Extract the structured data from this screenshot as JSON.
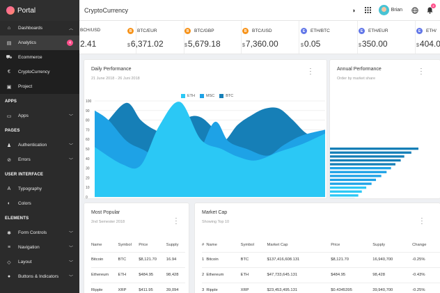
{
  "brand": {
    "name": "Portal"
  },
  "sidebar": {
    "items": [
      {
        "type": "item",
        "name": "dashboards",
        "label": "Dashboards",
        "icon": "home-icon",
        "glyph": "⌂",
        "chevron": "up"
      },
      {
        "type": "item",
        "name": "analytics",
        "label": "Analytics",
        "icon": "document-icon",
        "glyph": "▤",
        "sub": true,
        "active": true,
        "badge": "4"
      },
      {
        "type": "item",
        "name": "ecommerce",
        "label": "Ecommerce",
        "icon": "cart-icon",
        "glyph": "⛟",
        "sub": true
      },
      {
        "type": "item",
        "name": "cryptocurrency",
        "label": "CryptoCurrency",
        "icon": "euro-icon",
        "glyph": "€",
        "sub": true
      },
      {
        "type": "item",
        "name": "project",
        "label": "Project",
        "icon": "briefcase-icon",
        "glyph": "▣",
        "sub": true
      },
      {
        "type": "section",
        "label": "APPS"
      },
      {
        "type": "item",
        "name": "apps",
        "label": "Apps",
        "icon": "monitor-icon",
        "glyph": "▭",
        "chevron": "down"
      },
      {
        "type": "section",
        "label": "PAGES"
      },
      {
        "type": "item",
        "name": "authentication",
        "label": "Authentication",
        "icon": "user-icon",
        "glyph": "♟",
        "chevron": "down"
      },
      {
        "type": "item",
        "name": "errors",
        "label": "Errors",
        "icon": "alert-icon",
        "glyph": "⊘",
        "chevron": "down"
      },
      {
        "type": "section",
        "label": "USER INTERFACE"
      },
      {
        "type": "item",
        "name": "typography",
        "label": "Typography",
        "icon": "typography-icon",
        "glyph": "A"
      },
      {
        "type": "item",
        "name": "colors",
        "label": "Colors",
        "icon": "palette-icon",
        "glyph": "◐"
      },
      {
        "type": "section",
        "label": "ELEMENTS"
      },
      {
        "type": "item",
        "name": "form-controls",
        "label": "Form Controls",
        "icon": "star-icon",
        "glyph": "✱",
        "chevron": "down"
      },
      {
        "type": "item",
        "name": "navigation",
        "label": "Navigation",
        "icon": "menu-icon",
        "glyph": "≡",
        "chevron": "down"
      },
      {
        "type": "item",
        "name": "layout",
        "label": "Layout",
        "icon": "layout-icon",
        "glyph": "◇",
        "chevron": "down"
      },
      {
        "type": "item",
        "name": "buttons-indicators",
        "label": "Buttons & Indicators",
        "icon": "buttons-icon",
        "glyph": "●",
        "chevron": "down"
      }
    ]
  },
  "header": {
    "title": "CryptoCurrency",
    "user": "Brian",
    "notifications": "2"
  },
  "ticker": [
    {
      "pair": "BCH/USD",
      "value": "2.41",
      "currency": "",
      "coin_color": "",
      "coin_glyph": ""
    },
    {
      "pair": "BTC/EUR",
      "value": "6,371.02",
      "currency": "$",
      "coin_color": "#f7931a",
      "coin_glyph": "B"
    },
    {
      "pair": "BTC/GBP",
      "value": "5,679.18",
      "currency": "$",
      "coin_color": "#f7931a",
      "coin_glyph": "B"
    },
    {
      "pair": "BTC/USD",
      "value": "7,360.00",
      "currency": "$",
      "coin_color": "#f7931a",
      "coin_glyph": "B"
    },
    {
      "pair": "ETH/BTC",
      "value": "0.05",
      "currency": "$",
      "coin_color": "#6277e8",
      "coin_glyph": "E"
    },
    {
      "pair": "ETH/EUR",
      "value": "350.00",
      "currency": "$",
      "coin_color": "#6277e8",
      "coin_glyph": "E"
    },
    {
      "pair": "ETH/",
      "value": "404.0",
      "currency": "$",
      "coin_color": "#6277e8",
      "coin_glyph": "E"
    }
  ],
  "daily": {
    "title": "Daily Performance",
    "subtitle": "21 June 2018 - 26 Juni 2018"
  },
  "annual": {
    "title": "Annual Performance",
    "subtitle": "Order by market share"
  },
  "popular": {
    "title": "Most Popular",
    "subtitle": "2nd Semester 2018",
    "columns": [
      "Name",
      "Symbol",
      "Price",
      "Supply"
    ],
    "rows": [
      [
        "Bitcoin",
        "BTC",
        "$8,121.70",
        "16.94"
      ],
      [
        "Ethereum",
        "ETH",
        "$484.95",
        "98,428"
      ],
      [
        "Ripple",
        "XRP",
        "$411.95",
        "39,094"
      ]
    ]
  },
  "marketcap": {
    "title": "Market Cap",
    "subtitle": "Showing Top 10",
    "columns": [
      "#",
      "Name",
      "Symbol",
      "Market Cap",
      "Price",
      "Supply",
      "Change"
    ],
    "rows": [
      [
        "1",
        "Bitcoin",
        "BTC",
        "$137,416,608.131",
        "$8,121.70",
        "16,940,700",
        "-0.25%"
      ],
      [
        "2",
        "Ethereum",
        "ETH",
        "$47,733,645.131",
        "$484.95",
        "98,428",
        "-0.43%"
      ],
      [
        "3",
        "Ripple",
        "XRP",
        "$23,453,495.131",
        "$0.4345395",
        "39,940,700",
        "-0.25%"
      ]
    ]
  },
  "colors": {
    "eth": "#2bc8f5",
    "msc": "#1ea2e6",
    "btc": "#167fb7",
    "pink": "#ff4f8b"
  },
  "chart_data": [
    {
      "type": "area",
      "title": "Daily Performance",
      "series": [
        {
          "name": "ETH",
          "color": "#2bc8f5",
          "values": [
            [
              0,
              52
            ],
            [
              0.12,
              34
            ],
            [
              0.2,
              33
            ],
            [
              0.28,
              74
            ],
            [
              0.37,
              99
            ],
            [
              0.46,
              60
            ],
            [
              0.55,
              50
            ],
            [
              0.62,
              42
            ],
            [
              0.7,
              38
            ],
            [
              0.8,
              47
            ],
            [
              0.9,
              55
            ],
            [
              1,
              66
            ]
          ]
        },
        {
          "name": "MSC",
          "color": "#1ea2e6",
          "values": [
            [
              0,
              90
            ],
            [
              0.06,
              80
            ],
            [
              0.14,
              58
            ],
            [
              0.22,
              48
            ],
            [
              0.3,
              35
            ],
            [
              0.36,
              30
            ],
            [
              0.44,
              40
            ],
            [
              0.52,
              78
            ],
            [
              0.58,
              58
            ],
            [
              0.66,
              50
            ],
            [
              0.75,
              43
            ],
            [
              0.82,
              54
            ],
            [
              0.9,
              64
            ],
            [
              1,
              70
            ]
          ]
        },
        {
          "name": "BTC",
          "color": "#167fb7",
          "values": [
            [
              0,
              60
            ],
            [
              0.06,
              80
            ],
            [
              0.14,
              98
            ],
            [
              0.2,
              80
            ],
            [
              0.26,
              70
            ],
            [
              0.32,
              65
            ],
            [
              0.4,
              82
            ],
            [
              0.46,
              83
            ],
            [
              0.52,
              70
            ],
            [
              0.56,
              58
            ],
            [
              0.62,
              75
            ],
            [
              0.68,
              85
            ],
            [
              0.74,
              92
            ],
            [
              0.8,
              92
            ],
            [
              0.86,
              80
            ],
            [
              0.92,
              66
            ],
            [
              1,
              58
            ]
          ]
        }
      ],
      "xlabel": "",
      "ylabel": "",
      "yticks": [
        "0",
        "10",
        "20",
        "30",
        "40",
        "50",
        "60",
        "70",
        "80",
        "90",
        "100"
      ],
      "ylim": [
        0,
        100
      ],
      "grid": true,
      "legend": "top-center"
    },
    {
      "type": "bar",
      "title": "Annual Performance",
      "orientation": "horizontal",
      "values": [
        100,
        92,
        84,
        80,
        74,
        69,
        64,
        58,
        52,
        47,
        41,
        36,
        32,
        28,
        26
      ]
    }
  ]
}
